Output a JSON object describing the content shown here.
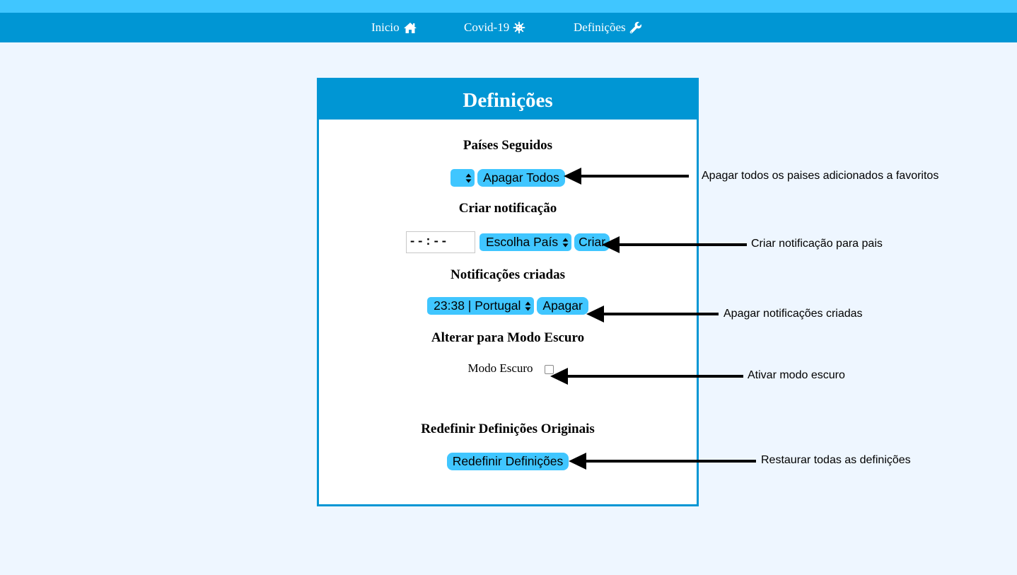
{
  "nav": {
    "items": [
      {
        "label": "Inicio",
        "icon": "home-icon"
      },
      {
        "label": "Covid-19",
        "icon": "virus-icon"
      },
      {
        "label": "Definições",
        "icon": "wrench-icon"
      }
    ]
  },
  "card": {
    "title": "Definições",
    "followed_countries": {
      "title": "Países Seguidos",
      "select_value": "",
      "delete_all_label": "Apagar Todos"
    },
    "create_notification": {
      "title": "Criar notificação",
      "time_value": "--:--",
      "country_select_value": "Escolha País",
      "create_label": "Criar"
    },
    "created_notifications": {
      "title": "Notificações criadas",
      "select_value": "23:38 | Portugal",
      "delete_label": "Apagar"
    },
    "dark_mode": {
      "title": "Alterar para Modo Escuro",
      "checkbox_label": "Modo Escuro",
      "checked": false
    },
    "reset": {
      "title": "Redefinir Definições Originais",
      "button_label": "Redefinir Definições"
    }
  },
  "annotations": {
    "delete_all": "Apagar todos os paises adicionados a favoritos",
    "create_notification": "Criar notificação para pais",
    "delete_notifications": "Apagar notificações criadas",
    "dark_mode": "Ativar modo escuro",
    "reset": "Restaurar todas as definições"
  },
  "colors": {
    "nav_bg": "#0096d4",
    "top_strip": "#40c6ff",
    "button_bg": "#40c6ff",
    "page_bg": "#eef6ff"
  }
}
